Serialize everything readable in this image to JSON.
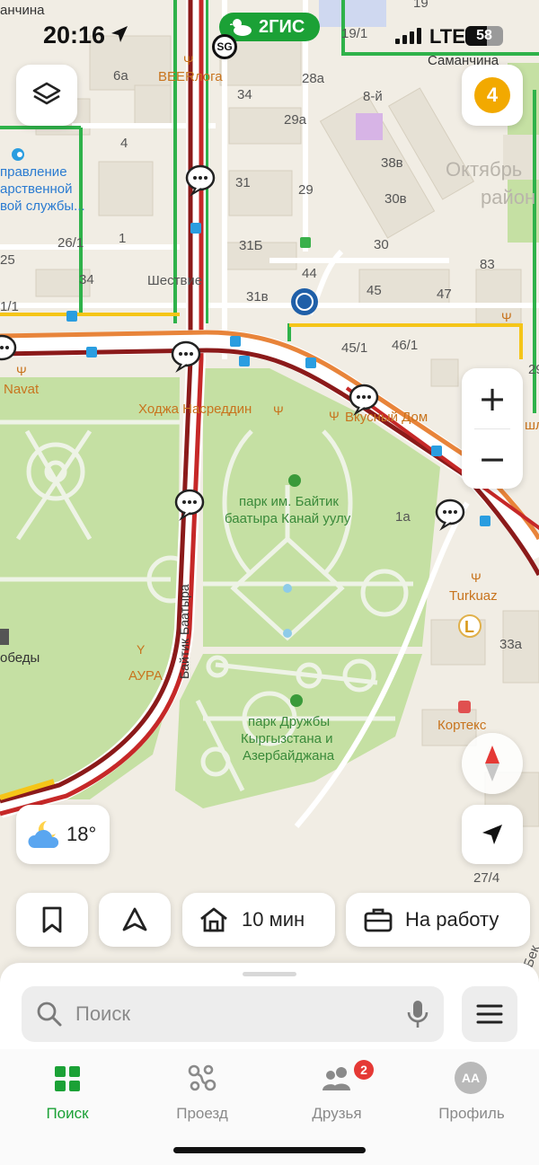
{
  "status_bar": {
    "time": "20:16",
    "network": "LTE",
    "battery": "58",
    "sg": "SG"
  },
  "brand": {
    "name": "2ГИС"
  },
  "map": {
    "district": [
      "Октябрь",
      "район"
    ],
    "streets": {
      "top_left": "анчина",
      "top_right": "Саманчина",
      "main_avenue": "Байтик Баатыра"
    },
    "org": [
      "правление",
      "арственной",
      "вой службы..."
    ],
    "buildings": [
      "6а",
      "19",
      "19/1",
      "34",
      "28а",
      "8-й",
      "29а",
      "4",
      "38в",
      "31",
      "29",
      "30в",
      "1",
      "26/1",
      "31Б",
      "30",
      "83",
      "25",
      "34",
      "44",
      "45",
      "47",
      "1/1",
      "31в",
      "45/1",
      "46/1",
      "29",
      "1а",
      "33а",
      "27/4"
    ],
    "pois": {
      "beerloga": "BEERлога",
      "shestvie": "Шествие",
      "navat": "Navat",
      "khodzha": "Ходжа Насреддин",
      "vkusny": "Вкусный Дом",
      "park1_l1": "парк им. Байтик",
      "park1_l2": "баатыра Канай уулу",
      "turkuaz": "Turkuaz",
      "pobedy": "обеды",
      "aura": "АУРА",
      "park2_l1": "парк Дружбы",
      "park2_l2": "Кыргызстана и",
      "park2_l3": "Азербайджана",
      "korteks": "Кортекс",
      "shl": "шл",
      "bek": "Бек"
    }
  },
  "controls": {
    "layers_icon": "layers-icon",
    "events_count": "4",
    "zoom_in": "+",
    "zoom_out": "−"
  },
  "weather": {
    "temp": "18°"
  },
  "quick": {
    "home": "10 мин",
    "work": "На работу"
  },
  "search": {
    "placeholder": "Поиск"
  },
  "tabs": [
    {
      "label": "Поиск",
      "active": true
    },
    {
      "label": "Проезд"
    },
    {
      "label": "Друзья",
      "badge": "2"
    },
    {
      "label": "Профиль",
      "avatar": "AA"
    }
  ],
  "colors": {
    "brand_green": "#1ba136",
    "traffic_red": "#c62828",
    "traffic_dark": "#8b1a1a",
    "park": "#c5e0a3",
    "badge": "#f2a900"
  }
}
